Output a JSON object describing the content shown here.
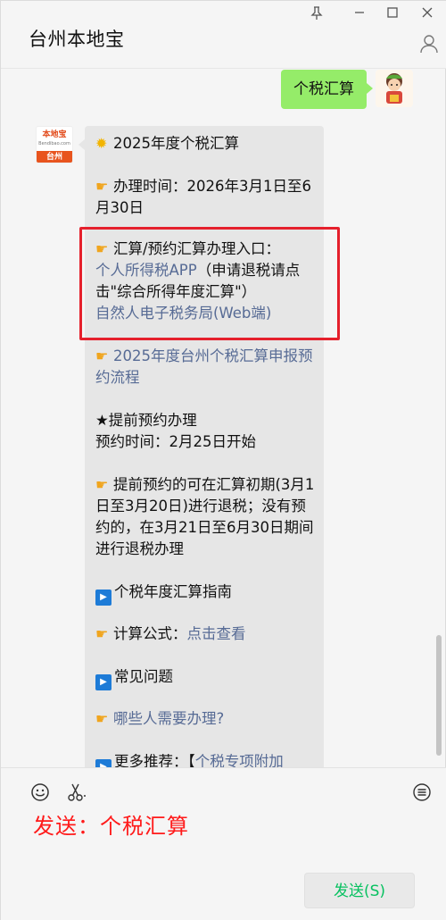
{
  "window": {
    "title": "台州本地宝",
    "controls": {
      "pin": "pin-icon",
      "minimize": "minimize-icon",
      "maximize": "maximize-icon",
      "close": "close-icon"
    }
  },
  "chat": {
    "outgoing": {
      "text": "个税汇算"
    },
    "bot": {
      "avatar_top": "本地宝",
      "avatar_sub": "Bendibao.com",
      "avatar_city": "台州",
      "lines": {
        "title": "2025年度个税汇算",
        "time_label": "办理时间：",
        "time_value": "2026年3月1日至6月30日",
        "entry_label": "汇算/预约汇算办理入口：",
        "entry_link1": "个人所得税APP",
        "entry_link1_note": "（申请退税请点击\"综合所得年度汇算\"）",
        "entry_link2": "自然人电子税务局(Web端)",
        "process_link": "2025年度台州个税汇算申报预约流程",
        "advance_title": "★提前预约办理",
        "advance_time": "预约时间：2月25日开始",
        "advance_note": "提前预约的可在汇算初期(3月1日至3月20日)进行退税；没有预约的，在3月21日至6月30日期间进行退税办理",
        "guide": "个税年度汇算指南",
        "formula_label": "计算公式：",
        "formula_link": "点击查看",
        "faq": "常见问题",
        "who_link": "哪些人需要办理?",
        "more_label": "更多推荐：【",
        "more_link": "个税专项附加"
      }
    }
  },
  "input": {
    "typed_text": "发送：个税汇算",
    "send_label": "发送(S)"
  },
  "colors": {
    "my_bubble": "#95ec69",
    "bot_bubble": "#e6e6e6",
    "link": "#576b95",
    "highlight_box": "#e5202c",
    "typed_text": "#ff1a1a",
    "send_text": "#07c160"
  }
}
